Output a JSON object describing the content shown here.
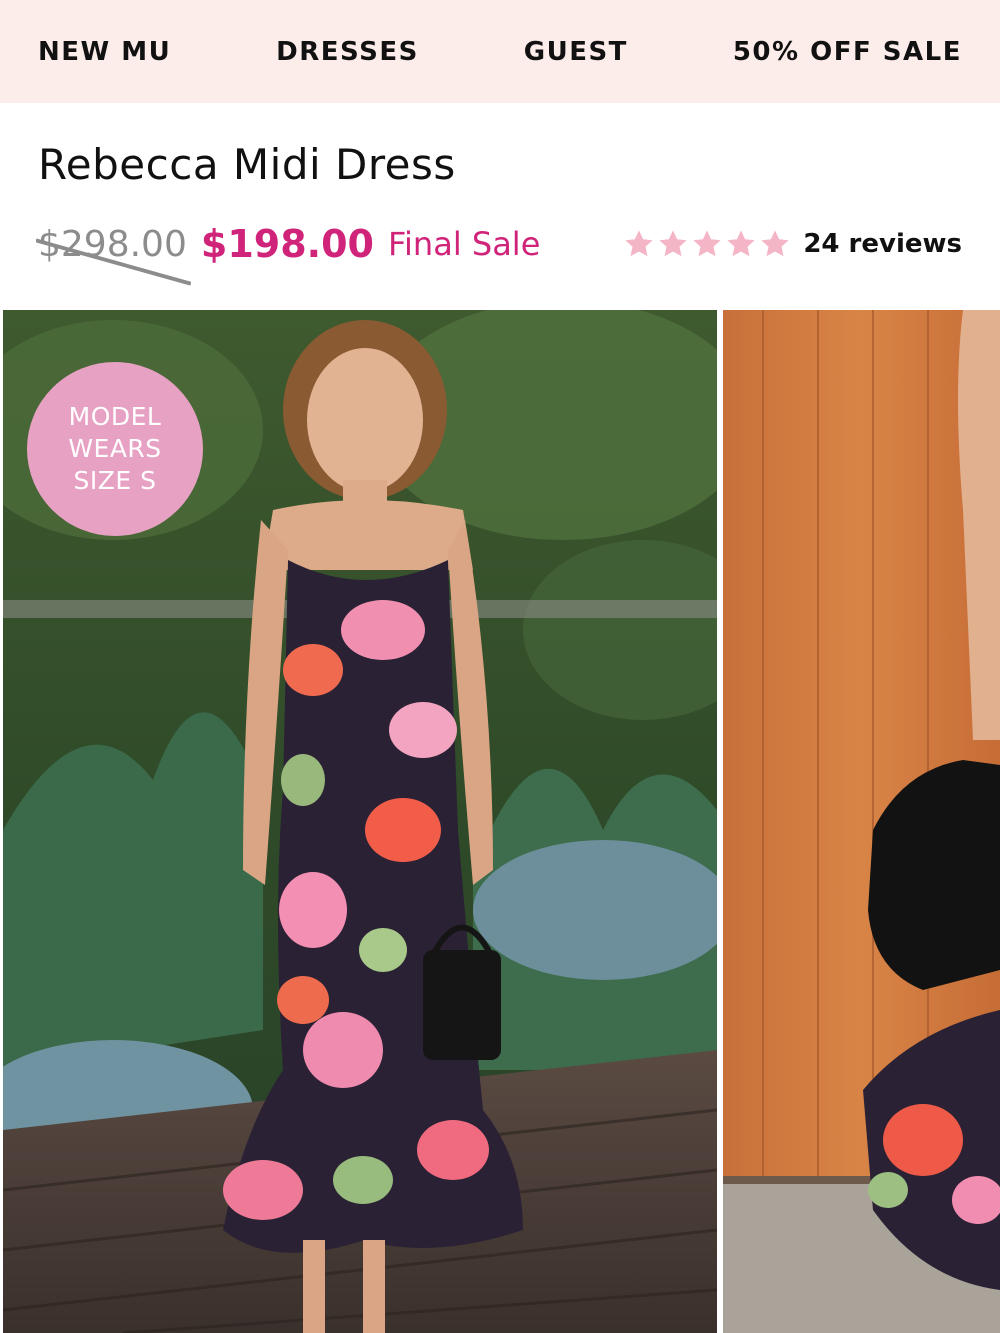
{
  "nav": {
    "items": [
      {
        "label": "NEW MU"
      },
      {
        "label": "DRESSES"
      },
      {
        "label": "GUEST"
      },
      {
        "label": "50% OFF SALE"
      }
    ]
  },
  "product": {
    "title": "Rebecca Midi Dress",
    "original_price": "$298.00",
    "sale_price": "$198.00",
    "sale_note": "Final Sale",
    "rating": {
      "stars": 5,
      "reviews_label": "24 reviews"
    }
  },
  "gallery": {
    "badge": "MODEL WEARS SIZE S",
    "images": [
      {
        "description_icon": "model-photo-garden"
      },
      {
        "description_icon": "model-photo-wood-wall"
      }
    ]
  },
  "colors": {
    "nav_background": "#fcecea",
    "accent_pink": "#d0247a",
    "badge_pink": "#e7a1c3",
    "star_pink": "#f4b6c6",
    "muted_gray": "#8c8c8c"
  }
}
